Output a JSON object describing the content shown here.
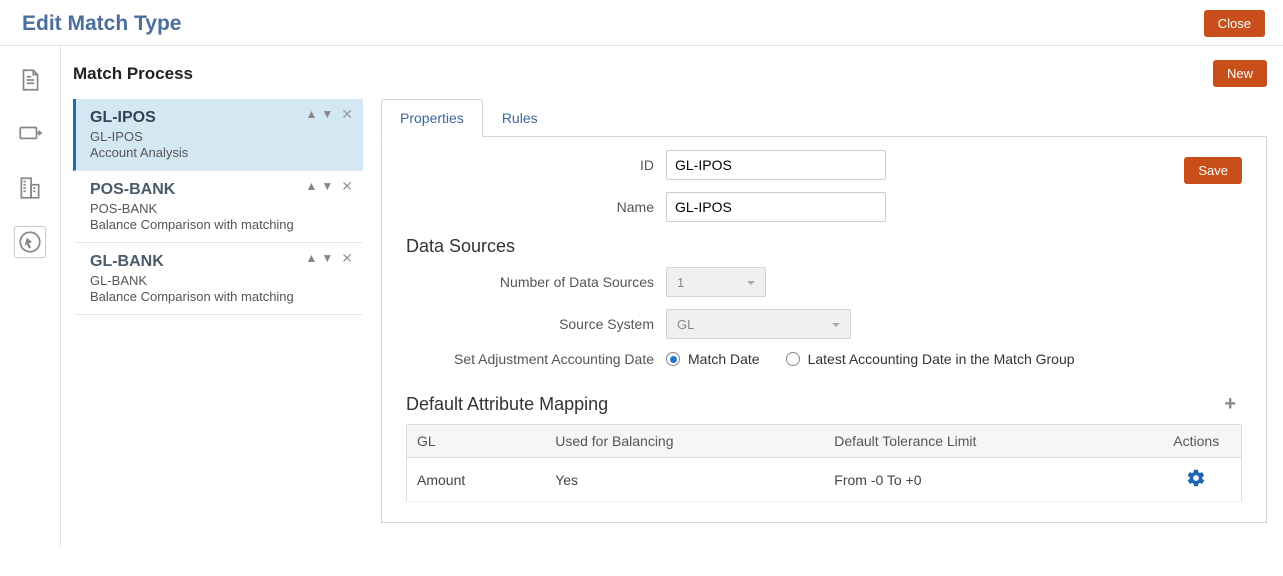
{
  "header": {
    "title": "Edit Match Type",
    "close_label": "Close"
  },
  "section": {
    "title": "Match Process",
    "new_label": "New"
  },
  "process_list": [
    {
      "title": "GL-IPOS",
      "id": "GL-IPOS",
      "desc": "Account Analysis",
      "selected": true
    },
    {
      "title": "POS-BANK",
      "id": "POS-BANK",
      "desc": "Balance Comparison with matching",
      "selected": false
    },
    {
      "title": "GL-BANK",
      "id": "GL-BANK",
      "desc": "Balance Comparison with matching",
      "selected": false
    }
  ],
  "tabs": {
    "properties": "Properties",
    "rules": "Rules",
    "active": "properties"
  },
  "form": {
    "save_label": "Save",
    "id_label": "ID",
    "id_value": "GL-IPOS",
    "name_label": "Name",
    "name_value": "GL-IPOS",
    "data_sources_title": "Data Sources",
    "num_sources_label": "Number of Data Sources",
    "num_sources_value": "1",
    "source_system_label": "Source System",
    "source_system_value": "GL",
    "adj_label": "Set Adjustment Accounting Date",
    "adj_opt1": "Match Date",
    "adj_opt2": "Latest Accounting Date in the Match Group",
    "adj_selected": "Match Date"
  },
  "mapping": {
    "title": "Default Attribute Mapping",
    "cols": {
      "c1": "GL",
      "c2": "Used for Balancing",
      "c3": "Default Tolerance Limit",
      "c4": "Actions"
    },
    "row": {
      "c1": "Amount",
      "c2": "Yes",
      "c3": "From -0 To +0"
    }
  }
}
